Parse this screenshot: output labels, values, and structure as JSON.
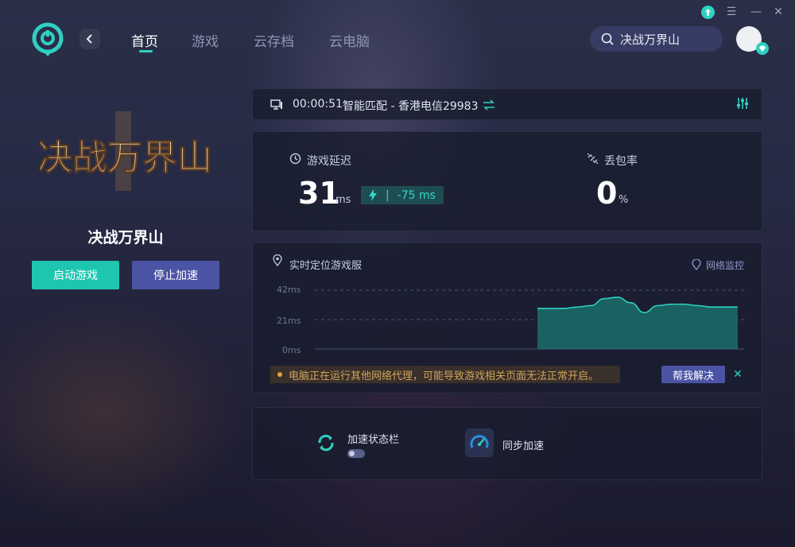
{
  "window": {
    "minimize_glyph": "—",
    "close_glyph": "✕",
    "menu_glyph": "☰"
  },
  "nav": {
    "back_icon": "chevron-left-icon",
    "tabs": [
      {
        "label": "首页",
        "active": true
      },
      {
        "label": "游戏",
        "active": false
      },
      {
        "label": "云存档",
        "active": false
      },
      {
        "label": "云电脑",
        "active": false
      }
    ]
  },
  "search": {
    "value": "决战万界山",
    "icon": "search-icon"
  },
  "game": {
    "logo_text": "决战万界山",
    "name": "决战万界山",
    "start_label": "启动游戏",
    "stop_label": "停止加速"
  },
  "status": {
    "timer": "00:00:51",
    "route": "智能匹配 - 香港电信29983",
    "icons": [
      "monitor-icon",
      "swap-icon",
      "settings-sliders-icon"
    ]
  },
  "latency": {
    "label": "游戏延迟",
    "value": "31",
    "unit": "ms",
    "delta": "-75 ms"
  },
  "loss": {
    "label": "丢包率",
    "value": "0",
    "unit": "%"
  },
  "monitor": {
    "title": "实时定位游戏服",
    "link": "网络监控",
    "axis": [
      "42ms",
      "21ms",
      "0ms"
    ],
    "warning": "电脑正在运行其他网络代理，可能导致游戏相关页面无法正常开启。",
    "help_label": "帮我解决",
    "close_glyph": "✕"
  },
  "chart_data": {
    "type": "area",
    "ylim": [
      0,
      42
    ],
    "yticks": [
      "42ms",
      "21ms",
      "0ms"
    ],
    "series": [
      {
        "values": [
          29,
          29,
          29,
          30,
          31,
          36,
          37,
          33,
          26,
          31,
          32,
          32,
          31,
          30,
          30,
          30
        ]
      }
    ],
    "colors": {
      "line": "#2fd0c2",
      "fill": "#1b6f6a"
    }
  },
  "tools": [
    {
      "label": "加速状态栏",
      "icon": "refresh-cycle-icon",
      "toggle": false
    },
    {
      "label": "同步加速",
      "icon": "speedometer-icon"
    }
  ],
  "colors": {
    "accent": "#2fd0c2",
    "primary_button": "#1ec6b0",
    "secondary_button": "#4b53a5"
  }
}
